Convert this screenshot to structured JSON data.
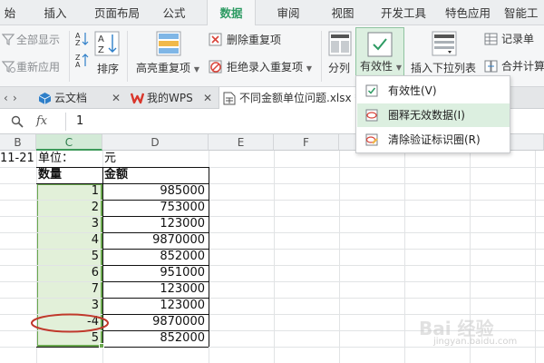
{
  "ribbon_tabs": [
    "始",
    "插入",
    "页面布局",
    "公式",
    "数据",
    "审阅",
    "视图",
    "开发工具",
    "特色应用",
    "智能工"
  ],
  "active_tab": "数据",
  "ribbon": {
    "show_all": "全部显示",
    "reapply": "重新应用",
    "sort": "排序",
    "highlight_dup": "高亮重复项",
    "remove_dup": "删除重复项",
    "reject_dup": "拒绝录入重复项",
    "split": "分列",
    "validity": "有效性",
    "insert_dropdown": "插入下拉列表",
    "record": "记录单",
    "merge_calc": "合并计算"
  },
  "doc_tabs": [
    {
      "label": "云文档",
      "icon": "cloud-cube-icon"
    },
    {
      "label": "我的WPS",
      "icon": "wps-logo-icon"
    },
    {
      "label": "不同金额单位问题.xlsx *",
      "icon": "spreadsheet-file-icon",
      "active": true
    }
  ],
  "formula_bar": {
    "fx": "fx",
    "value": "1"
  },
  "columns": [
    "B",
    "C",
    "D",
    "E",
    "F"
  ],
  "selected_column": "C",
  "sheet": {
    "b1": "11-21",
    "c1": "单位：",
    "d1": "元",
    "header_qty": "数量",
    "header_amount": "金额",
    "rows": [
      {
        "qty": "1",
        "amount": "985000"
      },
      {
        "qty": "2",
        "amount": "753000"
      },
      {
        "qty": "3",
        "amount": "123000"
      },
      {
        "qty": "4",
        "amount": "9870000"
      },
      {
        "qty": "5",
        "amount": "852000"
      },
      {
        "qty": "6",
        "amount": "951000"
      },
      {
        "qty": "7",
        "amount": "123000"
      },
      {
        "qty": "3",
        "amount": "123000"
      },
      {
        "qty": "-4",
        "amount": "9870000"
      },
      {
        "qty": "5",
        "amount": "852000"
      }
    ]
  },
  "menu": {
    "items": [
      "有效性(V)",
      "圈释无效数据(I)",
      "清除验证标识圈(R)"
    ],
    "highlighted": "圈释无效数据(I)"
  },
  "watermark": {
    "main": "Bai 经验",
    "sub": "jingyan.baidu.com"
  },
  "colors": {
    "accent": "#2e9b63",
    "selection": "#e2f0d9",
    "circle": "#c0392b"
  }
}
